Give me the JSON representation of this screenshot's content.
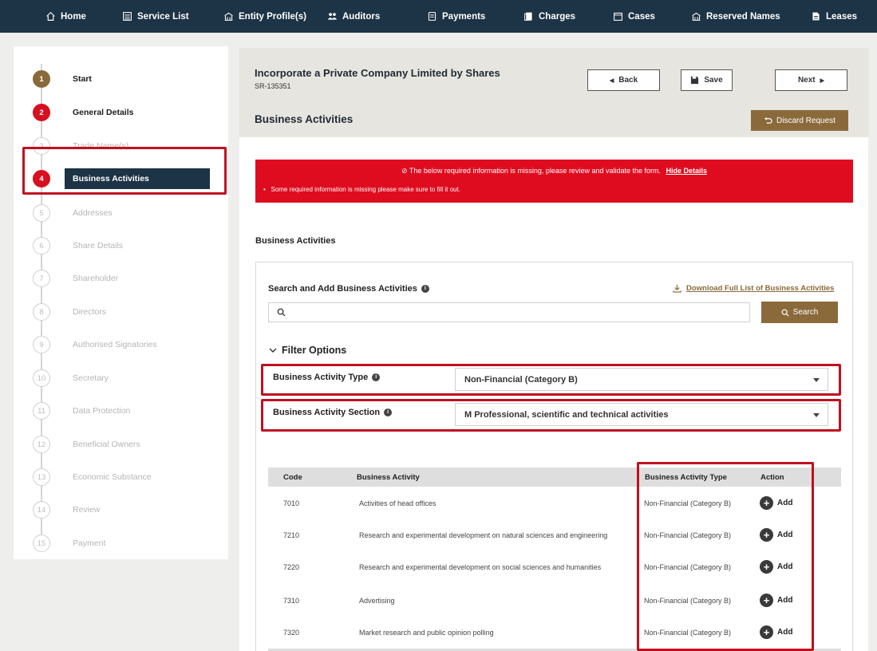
{
  "nav": {
    "items": [
      {
        "label": "Home",
        "icon": "home-icon"
      },
      {
        "label": "Service List",
        "icon": "list-icon"
      },
      {
        "label": "Entity Profile(s)",
        "icon": "building-icon"
      },
      {
        "label": "Auditors",
        "icon": "people-icon"
      },
      {
        "label": "Payments",
        "icon": "receipt-icon"
      },
      {
        "label": "Charges",
        "icon": "document-icon"
      },
      {
        "label": "Cases",
        "icon": "folder-icon"
      },
      {
        "label": "Reserved Names",
        "icon": "building-icon"
      },
      {
        "label": "Leases",
        "icon": "lease-icon"
      }
    ]
  },
  "steps": [
    {
      "num": "1",
      "label": "Start",
      "state": "done"
    },
    {
      "num": "2",
      "label": "General Details",
      "state": "error"
    },
    {
      "num": "3",
      "label": "Trade Name(s)",
      "state": "pending"
    },
    {
      "num": "4",
      "label": "Business Activities",
      "state": "active"
    },
    {
      "num": "5",
      "label": "Addresses",
      "state": "pending"
    },
    {
      "num": "6",
      "label": "Share Details",
      "state": "pending"
    },
    {
      "num": "7",
      "label": "Shareholder",
      "state": "pending"
    },
    {
      "num": "8",
      "label": "Directors",
      "state": "pending"
    },
    {
      "num": "9",
      "label": "Authorised Signatories",
      "state": "pending"
    },
    {
      "num": "10",
      "label": "Secretary",
      "state": "pending"
    },
    {
      "num": "11",
      "label": "Data Protection",
      "state": "pending"
    },
    {
      "num": "12",
      "label": "Beneficial Owners",
      "state": "pending"
    },
    {
      "num": "13",
      "label": "Economic Substance",
      "state": "pending"
    },
    {
      "num": "14",
      "label": "Review",
      "state": "pending"
    },
    {
      "num": "15",
      "label": "Payment",
      "state": "pending"
    }
  ],
  "header": {
    "title": "Incorporate a Private Company Limited by Shares",
    "sr_number": "SR-135351",
    "subtitle": "Business Activities",
    "back_label": "Back",
    "save_label": "Save",
    "next_label": "Next",
    "discard_label": "Discard Request"
  },
  "error_banner": {
    "message": "The below required information is missing, please review and validate the form.",
    "link": "Hide Details",
    "detail": "Some required information is missing please make sure to fill it out."
  },
  "section_title": "Business Activities",
  "search": {
    "label": "Search and Add Business Activities",
    "download_link": "Download Full List of Business Activities",
    "placeholder": "",
    "button": "Search"
  },
  "filters": {
    "header": "Filter Options",
    "type_label": "Business Activity Type",
    "type_value": "Non-Financial (Category B)",
    "section_label": "Business Activity Section",
    "section_value": "M Professional, scientific and technical activities"
  },
  "table": {
    "columns": {
      "code": "Code",
      "activity": "Business Activity",
      "type": "Business Activity Type",
      "action": "Action"
    },
    "add_label": "Add",
    "rows": [
      {
        "code": "7010",
        "activity": "Activities of head offices",
        "type": "Non-Financial (Category B)"
      },
      {
        "code": "7210",
        "activity": "Research and experimental development on natural sciences and engineering",
        "type": "Non-Financial (Category B)"
      },
      {
        "code": "7220",
        "activity": "Research and experimental development on social sciences and humanities",
        "type": "Non-Financial (Category B)"
      },
      {
        "code": "7310",
        "activity": "Advertising",
        "type": "Non-Financial (Category B)"
      },
      {
        "code": "7320",
        "activity": "Market research and public opinion polling",
        "type": "Non-Financial (Category B)"
      }
    ]
  },
  "colors": {
    "nav_bg": "#1d3346",
    "accent_gold": "#8a6a3b",
    "error_red": "#df0c1f",
    "highlight_red": "#c01020"
  }
}
